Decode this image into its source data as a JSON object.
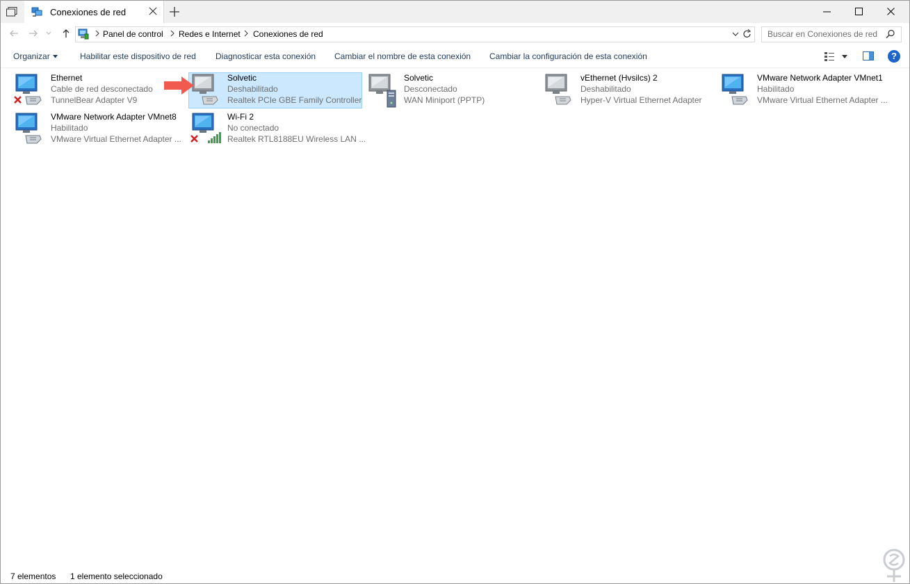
{
  "window": {
    "tab_title": "Conexiones de red",
    "icons": {
      "tab_icon": "network-connections-icon",
      "new_tab": "plus-icon",
      "close_tab": "close-icon"
    },
    "controls": [
      "minimize",
      "maximize",
      "close"
    ]
  },
  "address_bar": {
    "breadcrumb": [
      "Panel de control",
      "Redes e Internet",
      "Conexiones de red"
    ],
    "search_placeholder": "Buscar en Conexiones de red"
  },
  "command_bar": {
    "organize_label": "Organizar",
    "enable_label": "Habilitar este dispositivo de red",
    "diagnose_label": "Diagnosticar esta conexión",
    "rename_label": "Cambiar el nombre de esta conexión",
    "change_settings_label": "Cambiar la configuración de esta conexión",
    "help_label": "?"
  },
  "connections": [
    {
      "name": "Ethernet",
      "status": "Cable de red desconectado",
      "device": "TunnelBear Adapter V9",
      "icon": "ethernet-disconnected-icon",
      "selected": false
    },
    {
      "name": "Solvetic",
      "status": "Deshabilitado",
      "device": "Realtek PCIe GBE Family Controller",
      "icon": "ethernet-disabled-icon",
      "selected": true
    },
    {
      "name": "Solvetic",
      "status": "Desconectado",
      "device": "WAN Miniport (PPTP)",
      "icon": "vpn-connection-icon",
      "selected": false
    },
    {
      "name": "vEthernet (Hvsilcs) 2",
      "status": "Deshabilitado",
      "device": "Hyper-V Virtual Ethernet Adapter",
      "icon": "ethernet-disabled-icon",
      "selected": false
    },
    {
      "name": "VMware Network Adapter VMnet1",
      "status": "Habilitado",
      "device": "VMware Virtual Ethernet Adapter ...",
      "icon": "ethernet-enabled-icon",
      "selected": false
    },
    {
      "name": "VMware Network Adapter VMnet8",
      "status": "Habilitado",
      "device": "VMware Virtual Ethernet Adapter ...",
      "icon": "ethernet-enabled-icon",
      "selected": false
    },
    {
      "name": "Wi-Fi 2",
      "status": "No conectado",
      "device": "Realtek RTL8188EU Wireless LAN ...",
      "icon": "wifi-not-connected-icon",
      "selected": false
    }
  ],
  "status_bar": {
    "count": "7 elementos",
    "selection": "1 elemento seleccionado"
  },
  "colors": {
    "selection_bg": "#cce8ff",
    "selection_border": "#99d1ff",
    "command_text": "#1e395b",
    "secondary_text": "#6d6d6d",
    "annotation_arrow": "#f05a4f"
  }
}
